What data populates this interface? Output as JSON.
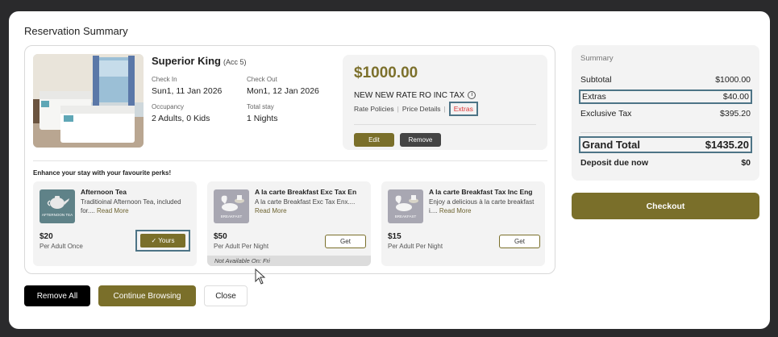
{
  "modal": {
    "title": "Reservation Summary"
  },
  "room": {
    "name": "Superior King",
    "acc": "(Acc 5)",
    "check_in_label": "Check In",
    "check_in": "Sun1, 11 Jan 2026",
    "check_out_label": "Check Out",
    "check_out": "Mon1, 12 Jan 2026",
    "occupancy_label": "Occupancy",
    "occupancy": "2 Adults, 0 Kids",
    "total_stay_label": "Total stay",
    "total_stay": "1 Nights",
    "image_icon": "hotel-room-photo"
  },
  "rate": {
    "price": "$1000.00",
    "name": "NEW NEW RATE RO INC TAX",
    "info_icon": "i",
    "links": [
      "Rate Policies",
      "Price Details",
      "Extras"
    ],
    "edit_label": "Edit",
    "remove_label": "Remove"
  },
  "perks": {
    "heading": "Enhance your stay with your favourite perks!",
    "items": [
      {
        "title": "Afternoon Tea",
        "desc": "Traditioinal Afternoon Tea, included for....",
        "read_more": "Read More",
        "price": "$20",
        "basis": "Per Adult Once",
        "action": "✓ Yours",
        "thumb_text": "AFTERNOON TEA"
      },
      {
        "title": "A la carte Breakfast Exc Tax En",
        "desc": "A la carte Breakfast Exc Tax Enx....",
        "read_more": "Read More",
        "price": "$50",
        "basis": "Per Adult Per Night",
        "action": "Get",
        "note": "Not Available On: Fri",
        "thumb_text": "BREAKFAST"
      },
      {
        "title": "A la carte Breakfast Tax Inc Eng",
        "desc": "Enjoy a delicious à la carte breakfast i....",
        "read_more": "Read More",
        "price": "$15",
        "basis": "Per Adult Per Night",
        "action": "Get",
        "thumb_text": "BREAKFAST"
      }
    ]
  },
  "footer": {
    "remove_all": "Remove All",
    "continue": "Continue Browsing",
    "close": "Close"
  },
  "summary": {
    "title": "Summary",
    "subtotal_label": "Subtotal",
    "subtotal": "$1000.00",
    "extras_label": "Extras",
    "extras": "$40.00",
    "tax_label": "Exclusive Tax",
    "tax": "$395.20",
    "grand_label": "Grand Total",
    "grand": "$1435.20",
    "deposit_label": "Deposit due now",
    "deposit": "$0",
    "checkout": "Checkout"
  },
  "colors": {
    "accent": "#7a6f2a",
    "highlight": "#4d7486",
    "danger": "#dd3333"
  }
}
